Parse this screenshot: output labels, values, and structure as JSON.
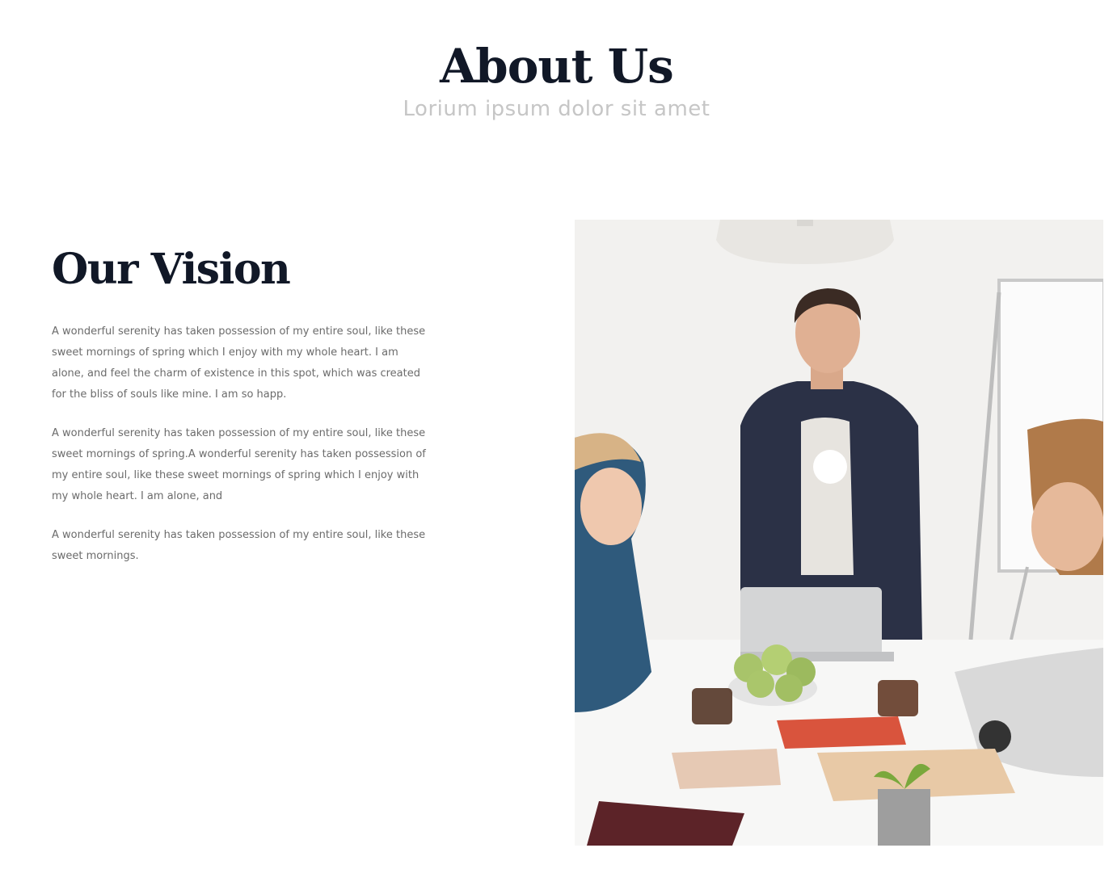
{
  "about": {
    "title": "About Us",
    "subtitle": "Lorium ipsum dolor sit amet"
  },
  "vision": {
    "title": "Our Vision",
    "paragraphs": [
      "A wonderful serenity has taken possession of my entire soul, like these sweet mornings of spring which I enjoy with my whole heart. I am alone, and feel the charm of existence in this spot, which was created for the bliss of souls like mine. I am so happ.",
      "A wonderful serenity has taken possession of my entire soul, like these sweet mornings of spring.A wonderful serenity has taken possession of my entire soul, like these sweet mornings of spring which I enjoy with my whole heart. I am alone, and",
      "A wonderful serenity has taken possession of my entire soul, like these sweet mornings."
    ]
  },
  "photo": {
    "icon": "team-meeting-photo",
    "overlay_icon": "play-dot-icon"
  }
}
